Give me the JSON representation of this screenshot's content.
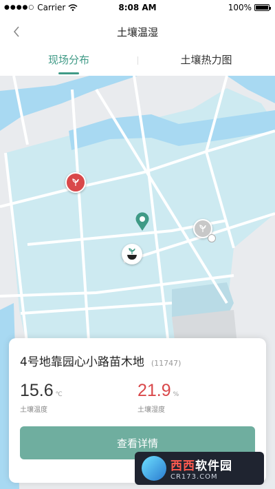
{
  "status_bar": {
    "carrier": "Carrier",
    "time": "8:08 AM",
    "battery": "100%"
  },
  "nav": {
    "title": "土壤温湿"
  },
  "tabs": [
    {
      "label": "现场分布",
      "active": true
    },
    {
      "label": "土壤热力图",
      "active": false
    }
  ],
  "card": {
    "title": "4号地靠园心小路苗木地",
    "id": "(11747)",
    "metrics": [
      {
        "value": "15.6",
        "unit": "℃",
        "label": "土壤温度",
        "color": "#333333"
      },
      {
        "value": "21.9",
        "unit": "%",
        "label": "土壤湿度",
        "color": "#d9484a"
      }
    ],
    "button_label": "查看详情"
  },
  "watermark": {
    "name_part1": "西西",
    "name_part2": "软件园",
    "url": "CR173.COM"
  },
  "colors": {
    "accent": "#3f9a86",
    "button": "#6fae9f",
    "map_zone": "#cdeaf1",
    "river": "#a8d9f2"
  }
}
